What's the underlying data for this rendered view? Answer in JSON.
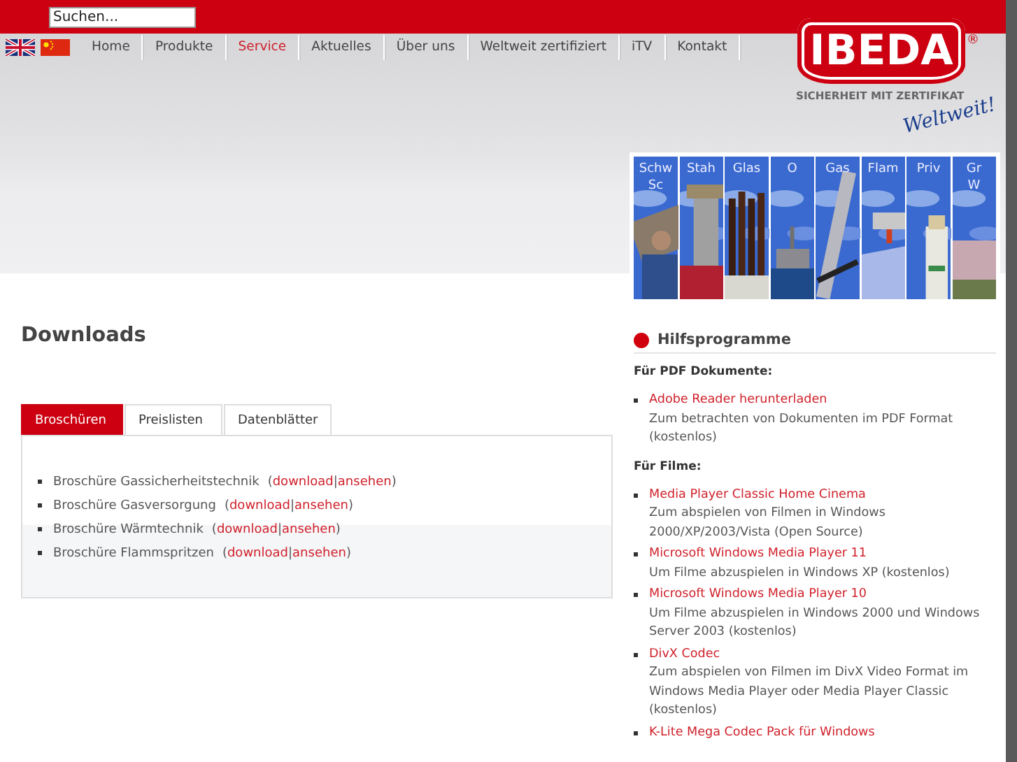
{
  "search": {
    "placeholder": "Suchen..."
  },
  "nav": [
    {
      "label": "Home",
      "selected": false
    },
    {
      "label": "Produkte",
      "selected": false
    },
    {
      "label": "Service",
      "selected": true
    },
    {
      "label": "Aktuelles",
      "selected": false
    },
    {
      "label": "Über uns",
      "selected": false
    },
    {
      "label": "Weltweit zertifiziert",
      "selected": false
    },
    {
      "label": "iTV",
      "selected": false
    },
    {
      "label": "Kontakt",
      "selected": false
    }
  ],
  "logo": {
    "brand": "IBEDA",
    "registered": "®",
    "tagline": "SICHERHEIT MIT ZERTIFIKAT",
    "slogan": "Weltweit!"
  },
  "banner": [
    {
      "lines": [
        "Schw",
        "Sc"
      ]
    },
    {
      "lines": [
        "Stah"
      ]
    },
    {
      "lines": [
        "Glas"
      ]
    },
    {
      "lines": [
        "O"
      ]
    },
    {
      "lines": [
        "Gas"
      ]
    },
    {
      "lines": [
        "Flam"
      ]
    },
    {
      "lines": [
        "Priv"
      ]
    },
    {
      "lines": [
        "Gr",
        "W"
      ]
    }
  ],
  "page_title": "Downloads",
  "tabs": [
    {
      "label": "Broschüren",
      "selected": true
    },
    {
      "label": "Preislisten",
      "selected": false
    },
    {
      "label": "Datenblätter",
      "selected": false
    }
  ],
  "downloads": [
    {
      "title": "Broschüre Gassicherheitstechnik",
      "open": "(",
      "download": "download",
      "separator": "|",
      "view": "ansehen",
      "close": ")"
    },
    {
      "title": "Broschüre Gasversorgung",
      "open": "(",
      "download": "download",
      "separator": "|",
      "view": "ansehen",
      "close": ")"
    },
    {
      "title": "Broschüre Wärmtechnik",
      "open": "(",
      "download": "download",
      "separator": "|",
      "view": "ansehen",
      "close": ")"
    },
    {
      "title": "Broschüre Flammspritzen",
      "open": "(",
      "download": "download",
      "separator": "|",
      "view": "ansehen",
      "close": ")"
    }
  ],
  "sidebar": {
    "title": "Hilfsprogramme",
    "sections": [
      {
        "heading": "Für PDF Dokumente:",
        "items": [
          {
            "link": "Adobe Reader herunterladen",
            "description": "Zum betrachten von Dokumenten im PDF Format (kostenlos)"
          }
        ]
      },
      {
        "heading": "Für Filme:",
        "items": [
          {
            "link": "Media Player Classic Home Cinema",
            "description": "Zum abspielen von Filmen in Windows 2000/XP/2003/Vista (Open Source)"
          },
          {
            "link": "Microsoft Windows Media Player 11",
            "description": "Um Filme abzuspielen in Windows XP (kostenlos)"
          },
          {
            "link": "Microsoft Windows Media Player 10",
            "description": "Um Filme abzuspielen in Windows 2000 und Windows Server 2003 (kostenlos)"
          },
          {
            "link": "DivX Codec",
            "description": "Zum abspielen von Filmen im DivX Video Format im Windows Media Player oder Media Player Classic (kostenlos)"
          },
          {
            "link": "K-Lite Mega Codec Pack für Windows"
          }
        ]
      }
    ]
  }
}
